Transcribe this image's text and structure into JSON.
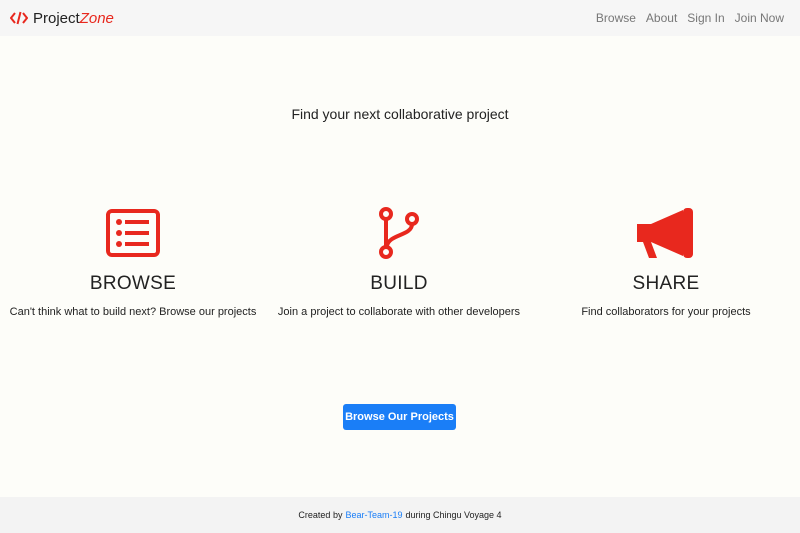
{
  "nav": {
    "brand_plain": "Project",
    "brand_italic": "Zone",
    "links": [
      "Browse",
      "About",
      "Sign In",
      "Join Now"
    ]
  },
  "hero": {
    "title": "Find your next collaborative project"
  },
  "features": [
    {
      "icon": "list-icon",
      "title": "BROWSE",
      "text": "Can't think what to build next? Browse our projects"
    },
    {
      "icon": "branch-icon",
      "title": "BUILD",
      "text": "Join a project to collaborate with other developers"
    },
    {
      "icon": "megaphone-icon",
      "title": "SHARE",
      "text": "Find collaborators for your projects"
    }
  ],
  "cta": {
    "label": "Browse Our Projects"
  },
  "footer": {
    "prefix": "Created by",
    "link": "Bear-Team-19",
    "suffix": "during Chingu Voyage 4"
  },
  "colors": {
    "accent": "#e8281e",
    "primary": "#1a7ef7"
  }
}
